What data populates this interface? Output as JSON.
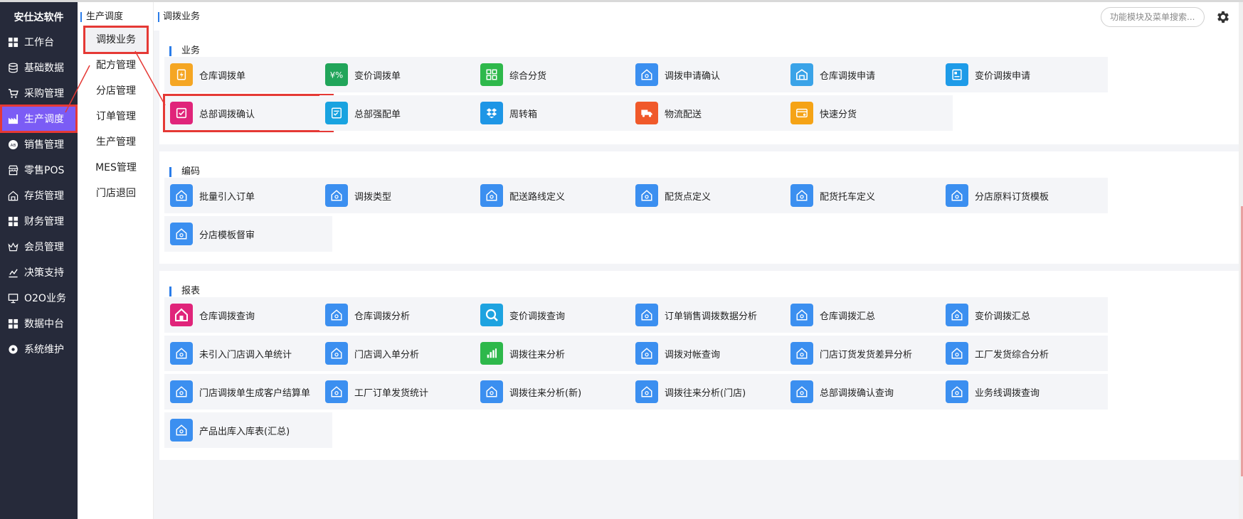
{
  "brand": "安仕达软件",
  "sidebar": {
    "items": [
      {
        "label": "工作台",
        "icon": "dashboard-icon"
      },
      {
        "label": "基础数据",
        "icon": "database-icon"
      },
      {
        "label": "采购管理",
        "icon": "cart-icon"
      },
      {
        "label": "生产调度",
        "icon": "factory-icon",
        "active": true
      },
      {
        "label": "销售管理",
        "icon": "sales-icon"
      },
      {
        "label": "零售POS",
        "icon": "store-icon"
      },
      {
        "label": "存货管理",
        "icon": "warehouse-icon"
      },
      {
        "label": "财务管理",
        "icon": "finance-icon"
      },
      {
        "label": "会员管理",
        "icon": "crown-icon"
      },
      {
        "label": "决策支持",
        "icon": "decision-icon"
      },
      {
        "label": "O2O业务",
        "icon": "monitor-icon"
      },
      {
        "label": "数据中台",
        "icon": "grid-icon"
      },
      {
        "label": "系统维护",
        "icon": "settings-icon"
      }
    ]
  },
  "subnav": {
    "title": "生产调度",
    "items": [
      "调拨业务",
      "配方管理",
      "分店管理",
      "订单管理",
      "生产管理",
      "MES管理",
      "门店退回"
    ]
  },
  "header": {
    "breadcrumb": "调拨业务",
    "search_placeholder": "功能模块及菜单搜索..."
  },
  "sections": [
    {
      "title": "业务",
      "tiles": [
        {
          "label": "仓库调拨单",
          "color": "#f5a623",
          "icon": "lightning-doc-icon"
        },
        {
          "label": "变价调拨单",
          "color": "#21a55a",
          "icon": "price-tag-icon"
        },
        {
          "label": "综合分货",
          "color": "#2eb84b",
          "icon": "grid-icon"
        },
        {
          "label": "调拨申请确认",
          "color": "#3b8ff0",
          "icon": "home-icon"
        },
        {
          "label": "仓库调拨申请",
          "color": "#3aa3e8",
          "icon": "warehouse-icon"
        },
        {
          "label": "变价调拨申请",
          "color": "#1e9be8",
          "icon": "form-icon"
        },
        {
          "label": "总部调拨确认",
          "color": "#e0247a",
          "icon": "check-box-icon"
        },
        {
          "label": "总部强配单",
          "color": "#19a3e0",
          "icon": "checklist-icon"
        },
        {
          "label": "周转箱",
          "color": "#1e96e6",
          "icon": "dropbox-icon"
        },
        {
          "label": "物流配送",
          "color": "#f0592a",
          "icon": "truck-icon"
        },
        {
          "label": "快速分货",
          "color": "#f5a316",
          "icon": "card-icon"
        }
      ]
    },
    {
      "title": "编码",
      "tiles": [
        {
          "label": "批量引入订单",
          "color": "#3b8ff0",
          "icon": "home-icon"
        },
        {
          "label": "调拨类型",
          "color": "#3b8ff0",
          "icon": "home-icon"
        },
        {
          "label": "配送路线定义",
          "color": "#3b8ff0",
          "icon": "home-icon"
        },
        {
          "label": "配货点定义",
          "color": "#3b8ff0",
          "icon": "home-icon"
        },
        {
          "label": "配货托车定义",
          "color": "#3b8ff0",
          "icon": "home-icon"
        },
        {
          "label": "分店原料订货模板",
          "color": "#3b8ff0",
          "icon": "home-icon"
        },
        {
          "label": "分店模板督审",
          "color": "#3b8ff0",
          "icon": "home-icon"
        }
      ]
    },
    {
      "title": "报表",
      "tiles": [
        {
          "label": "仓库调拨查询",
          "color": "#e0247a",
          "icon": "house-icon"
        },
        {
          "label": "仓库调拨分析",
          "color": "#3b8ff0",
          "icon": "home-icon"
        },
        {
          "label": "变价调拨查询",
          "color": "#1ea3e0",
          "icon": "magnifier-icon"
        },
        {
          "label": "订单销售调拨数据分析",
          "color": "#3b8ff0",
          "icon": "home-icon"
        },
        {
          "label": "仓库调拨汇总",
          "color": "#3b8ff0",
          "icon": "home-icon"
        },
        {
          "label": "变价调拨汇总",
          "color": "#3b8ff0",
          "icon": "home-icon"
        },
        {
          "label": "未引入门店调入单统计",
          "color": "#3b8ff0",
          "icon": "home-icon"
        },
        {
          "label": "门店调入单分析",
          "color": "#3b8ff0",
          "icon": "home-icon"
        },
        {
          "label": "调拨往来分析",
          "color": "#2eb84b",
          "icon": "bar-chart-icon"
        },
        {
          "label": "调拨对帐查询",
          "color": "#3b8ff0",
          "icon": "home-icon"
        },
        {
          "label": "门店订货发货差异分析",
          "color": "#3b8ff0",
          "icon": "home-icon"
        },
        {
          "label": "工厂发货综合分析",
          "color": "#3b8ff0",
          "icon": "home-icon"
        },
        {
          "label": "门店调拨单生成客户结算单",
          "color": "#3b8ff0",
          "icon": "home-icon"
        },
        {
          "label": "工厂订单发货统计",
          "color": "#3b8ff0",
          "icon": "home-icon"
        },
        {
          "label": "调拨往来分析(新)",
          "color": "#3b8ff0",
          "icon": "home-icon"
        },
        {
          "label": "调拨往来分析(门店)",
          "color": "#3b8ff0",
          "icon": "home-icon"
        },
        {
          "label": "总部调拨确认查询",
          "color": "#3b8ff0",
          "icon": "home-icon"
        },
        {
          "label": "业务线调拨查询",
          "color": "#3b8ff0",
          "icon": "home-icon"
        },
        {
          "label": "产品出库入库表(汇总)",
          "color": "#3b8ff0",
          "icon": "home-icon"
        }
      ]
    }
  ]
}
